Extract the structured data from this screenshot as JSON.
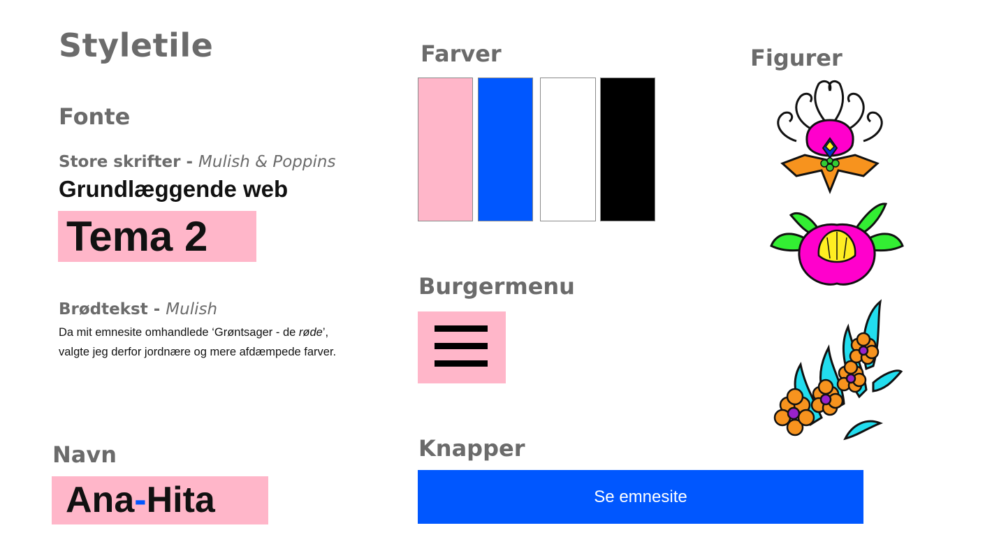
{
  "title": "Styletile",
  "fonts": {
    "heading": "Fonte",
    "large": {
      "label": "Store skrifter",
      "sep": " - ",
      "families": "Mulish & Poppins"
    },
    "sample_title": "Grundlæggende web",
    "sample_theme": "Tema 2",
    "body": {
      "label": "Brødtekst",
      "sep": " - ",
      "families": "Mulish"
    },
    "body_text_line1_a": "Da mit emnesite omhandlede ‘Grøntsager - de ",
    "body_text_line1_em": "røde",
    "body_text_line1_b": "’,",
    "body_text_line2": "valgte jeg derfor jordnære og mere afdæmpede farver."
  },
  "name": {
    "heading": "Navn",
    "part1": "Ana",
    "hyphen": "-",
    "part2": "Hita"
  },
  "colors": {
    "heading": "Farver",
    "swatches": [
      "#ffb6c9",
      "#0057ff",
      "#ffffff",
      "#000000"
    ]
  },
  "burger": {
    "heading": "Burgermenu",
    "icon": "hamburger-menu-icon"
  },
  "buttons": {
    "heading": "Knapper",
    "cta_label": "Se emnesite"
  },
  "figures": {
    "heading": "Figurer",
    "items": [
      "flower-ornament-1-icon",
      "flower-ornament-2-icon",
      "flower-ornament-3-icon"
    ]
  }
}
